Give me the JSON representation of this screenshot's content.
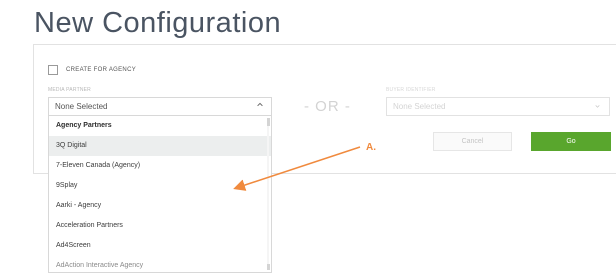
{
  "page": {
    "title": "New Configuration"
  },
  "checkbox": {
    "label": "CREATE FOR AGENCY"
  },
  "media_partner": {
    "label": "MEDIA PARTNER",
    "selected_value": "None Selected"
  },
  "buyer_field": {
    "label": "BUYER IDENTIFIER",
    "selected_value": "None Selected"
  },
  "divider": {
    "text": "- OR -"
  },
  "actions": {
    "cancel_label": "Cancel",
    "go_label": "Go"
  },
  "dropdown": {
    "items": [
      {
        "label": "Agency Partners",
        "type": "header"
      },
      {
        "label": "3Q Digital",
        "type": "option",
        "highlighted": true
      },
      {
        "label": "7-Eleven Canada (Agency)",
        "type": "option"
      },
      {
        "label": "9Splay",
        "type": "option"
      },
      {
        "label": "Aarki - Agency",
        "type": "option"
      },
      {
        "label": "Acceleration Partners",
        "type": "option"
      },
      {
        "label": "Ad4Screen",
        "type": "option"
      },
      {
        "label": "AdAction Interactive Agency",
        "type": "option",
        "partial": true
      }
    ]
  },
  "annotation": {
    "label": "A.",
    "color": "#f08a3e"
  },
  "icons": {
    "media_chevron": "chevron-up-icon",
    "buyer_chevron": "chevron-down-icon"
  },
  "colors": {
    "go_button": "#59a62d",
    "annotation": "#f08a3e"
  }
}
